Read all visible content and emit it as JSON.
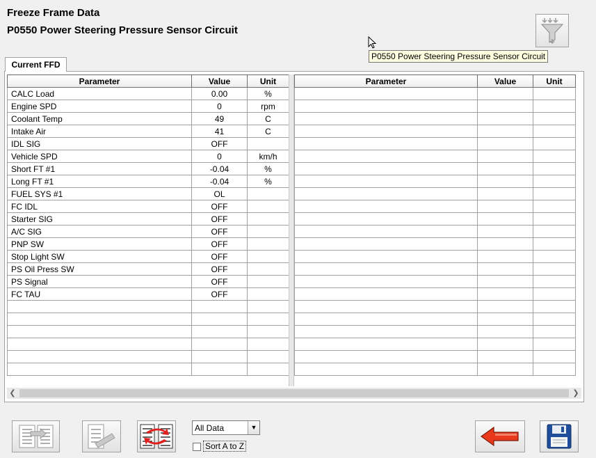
{
  "header": {
    "title": "Freeze Frame Data",
    "subtitle": "P0550 Power Steering Pressure Sensor Circuit"
  },
  "tooltip": "P0550 Power Steering Pressure Sensor Circuit",
  "tab": {
    "label": "Current FFD"
  },
  "columns": {
    "parameter": "Parameter",
    "value": "Value",
    "unit": "Unit"
  },
  "rows": [
    {
      "parameter": "CALC Load",
      "value": "0.00",
      "unit": "%"
    },
    {
      "parameter": "Engine SPD",
      "value": "0",
      "unit": "rpm"
    },
    {
      "parameter": "Coolant Temp",
      "value": "49",
      "unit": "C"
    },
    {
      "parameter": "Intake Air",
      "value": "41",
      "unit": "C"
    },
    {
      "parameter": "IDL SIG",
      "value": "OFF",
      "unit": ""
    },
    {
      "parameter": "Vehicle SPD",
      "value": "0",
      "unit": "km/h"
    },
    {
      "parameter": "Short FT #1",
      "value": "-0.04",
      "unit": "%"
    },
    {
      "parameter": "Long FT #1",
      "value": "-0.04",
      "unit": "%"
    },
    {
      "parameter": "FUEL SYS #1",
      "value": "OL",
      "unit": ""
    },
    {
      "parameter": "FC IDL",
      "value": "OFF",
      "unit": ""
    },
    {
      "parameter": "Starter SIG",
      "value": "OFF",
      "unit": ""
    },
    {
      "parameter": "A/C SIG",
      "value": "OFF",
      "unit": ""
    },
    {
      "parameter": "PNP SW",
      "value": "OFF",
      "unit": ""
    },
    {
      "parameter": "Stop Light SW",
      "value": "OFF",
      "unit": ""
    },
    {
      "parameter": "PS Oil Press SW",
      "value": "OFF",
      "unit": ""
    },
    {
      "parameter": "PS Signal",
      "value": "OFF",
      "unit": ""
    },
    {
      "parameter": "FC TAU",
      "value": "OFF",
      "unit": ""
    }
  ],
  "toolbar": {
    "filter_select_value": "All Data",
    "sort_label": "Sort A to Z",
    "sort_checked": false
  },
  "icons": {
    "filter": "filter-funnel-icon",
    "list_arrow": "list-arrow-icon",
    "checklist_pen": "checklist-pen-icon",
    "swap_lists": "swap-lists-icon",
    "back": "back-arrow-icon",
    "save": "floppy-save-icon"
  },
  "colors": {
    "back_arrow": "#e8391d",
    "swap_arrows": "#e02020",
    "save_disk": "#1f4f9a",
    "tooltip_bg": "#ffffe1"
  }
}
